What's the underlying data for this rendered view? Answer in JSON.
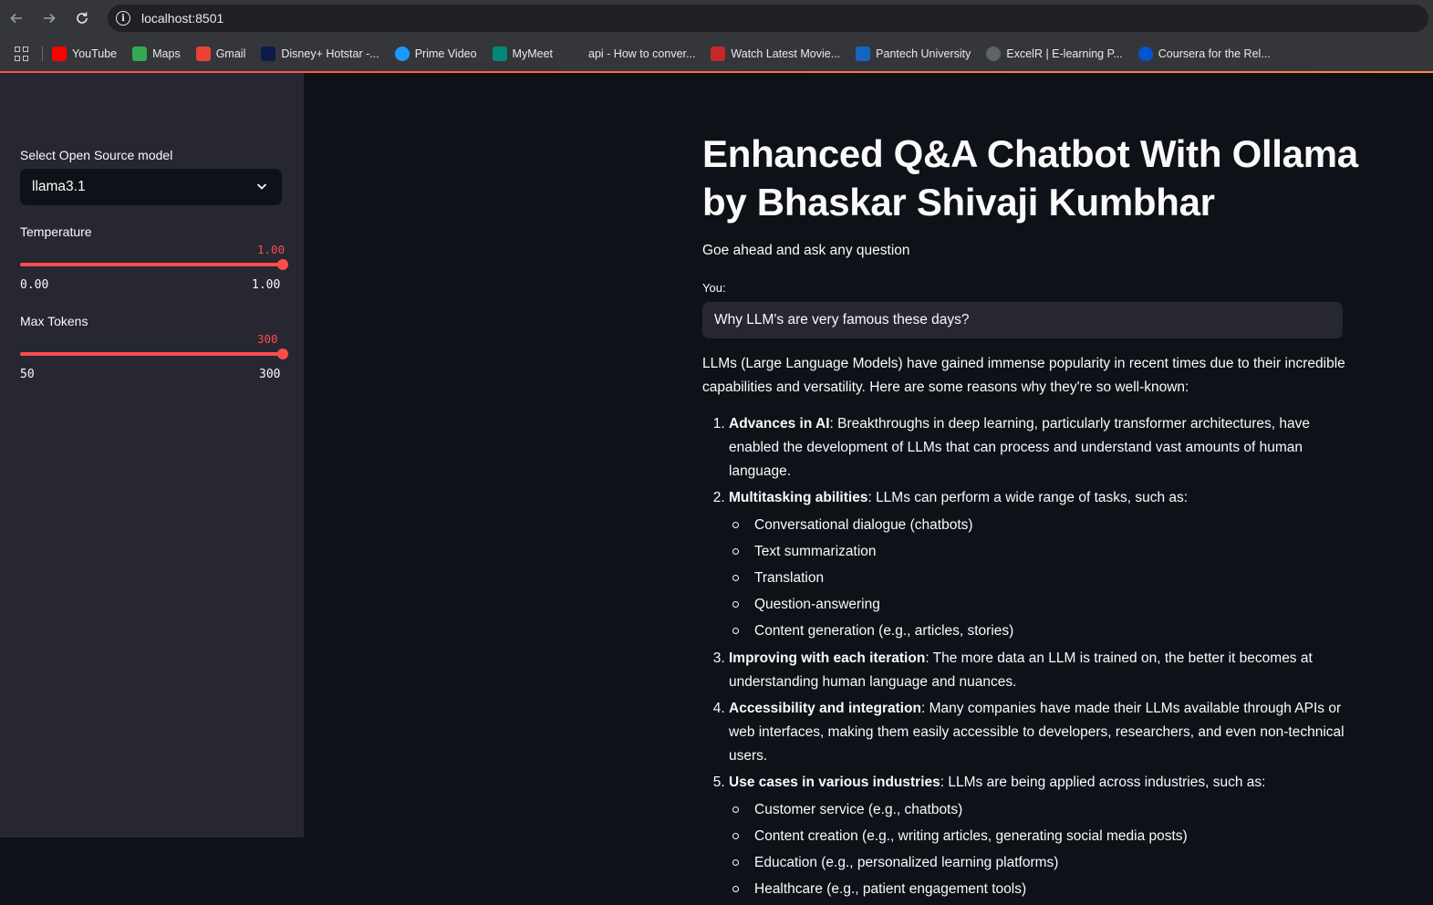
{
  "browser": {
    "url": "localhost:8501",
    "bookmarks": [
      {
        "label": "YouTube",
        "icon": "youtube-icon",
        "color": "#ff0000"
      },
      {
        "label": "Maps",
        "icon": "maps-icon",
        "color": "#34a853"
      },
      {
        "label": "Gmail",
        "icon": "gmail-icon",
        "color": "#ea4335"
      },
      {
        "label": "Disney+ Hotstar -...",
        "icon": "hotstar-icon",
        "color": "#0c1b4d"
      },
      {
        "label": "Prime Video",
        "icon": "prime-video-icon",
        "color": "#1a98ff"
      },
      {
        "label": "MyMeet",
        "icon": "mymeet-icon",
        "color": "#00897b"
      },
      {
        "label": "api - How to conver...",
        "icon": "stackoverflow-icon",
        "color": "#35363a"
      },
      {
        "label": "Watch Latest Movie...",
        "icon": "movie-icon",
        "color": "#c62828"
      },
      {
        "label": "Pantech University",
        "icon": "pantech-icon",
        "color": "#1565c0"
      },
      {
        "label": "ExcelR | E-learning P...",
        "icon": "globe-icon",
        "color": "#5f6368"
      },
      {
        "label": "Coursera for the Rel...",
        "icon": "coursera-icon",
        "color": "#0056d2"
      }
    ]
  },
  "sidebar": {
    "model_label": "Select Open Source model",
    "model_value": "llama3.1",
    "temperature": {
      "label": "Temperature",
      "value": "1.00",
      "min": "0.00",
      "max": "1.00",
      "fraction": 1.0
    },
    "max_tokens": {
      "label": "Max Tokens",
      "value": "300",
      "min": "50",
      "max": "300",
      "fraction": 1.0
    }
  },
  "main": {
    "title": "Enhanced Q&A Chatbot With Ollama by Bhaskar Shivaji Kumbhar",
    "subtitle": "Goe ahead and ask any question",
    "input_label": "You:",
    "input_value": "Why LLM's are very famous these days?",
    "answer_intro": "LLMs (Large Language Models) have gained immense popularity in recent times due to their incredible capabilities and versatility. Here are some reasons why they're so well-known:",
    "points": [
      {
        "heading": "Advances in AI",
        "text": ": Breakthroughs in deep learning, particularly transformer architectures, have enabled the development of LLMs that can process and understand vast amounts of human language."
      },
      {
        "heading": "Multitasking abilities",
        "text": ": LLMs can perform a wide range of tasks, such as:",
        "sub": [
          "Conversational dialogue (chatbots)",
          "Text summarization",
          "Translation",
          "Question-answering",
          "Content generation (e.g., articles, stories)"
        ]
      },
      {
        "heading": "Improving with each iteration",
        "text": ": The more data an LLM is trained on, the better it becomes at understanding human language and nuances."
      },
      {
        "heading": "Accessibility and integration",
        "text": ": Many companies have made their LLMs available through APIs or web interfaces, making them easily accessible to developers, researchers, and even non-technical users."
      },
      {
        "heading": "Use cases in various industries",
        "text": ": LLMs are being applied across industries, such as:",
        "sub": [
          "Customer service (e.g., chatbots)",
          "Content creation (e.g., writing articles, generating social media posts)",
          "Education (e.g., personalized learning platforms)",
          "Healthcare (e.g., patient engagement tools)"
        ]
      }
    ]
  },
  "colors": {
    "accent": "#ff4b4b",
    "sidebar_bg": "#262730",
    "main_bg": "#0e1117"
  }
}
